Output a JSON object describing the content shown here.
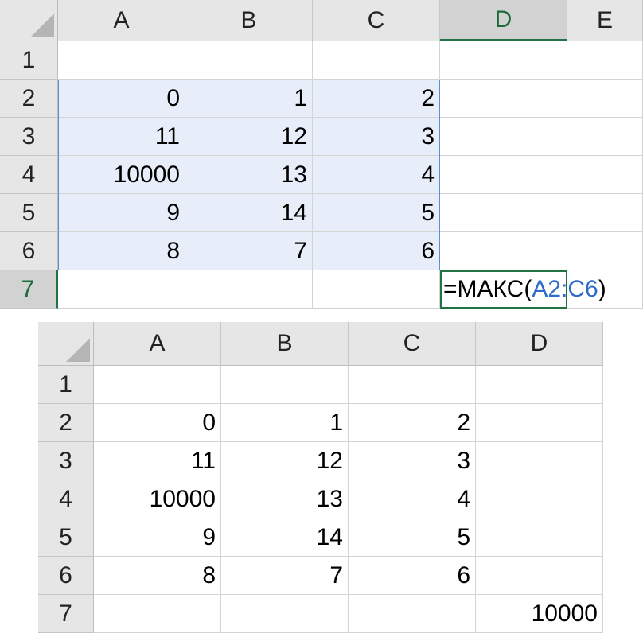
{
  "top_sheet": {
    "columns": [
      "A",
      "B",
      "C",
      "D",
      "E"
    ],
    "rows": [
      "1",
      "2",
      "3",
      "4",
      "5",
      "6",
      "7"
    ],
    "cells": [
      [
        "",
        "",
        "",
        "",
        ""
      ],
      [
        "0",
        "1",
        "2",
        "",
        ""
      ],
      [
        "11",
        "12",
        "3",
        "",
        ""
      ],
      [
        "10000",
        "13",
        "4",
        "",
        ""
      ],
      [
        "9",
        "14",
        "5",
        "",
        ""
      ],
      [
        "8",
        "7",
        "6",
        "",
        ""
      ],
      [
        "",
        "",
        "",
        "",
        ""
      ]
    ],
    "selected_column": "D",
    "selected_row": "7",
    "formula": {
      "prefix": "=МАКС(",
      "range_ref": "A2:C6",
      "suffix": ")"
    },
    "colors": {
      "selection_accent": "#217346",
      "range_fill": "#e8eef9",
      "range_border": "#5a8ed6",
      "range_ref_text": "#2f6cc9"
    }
  },
  "bottom_sheet": {
    "columns": [
      "A",
      "B",
      "C",
      "D"
    ],
    "rows": [
      "1",
      "2",
      "3",
      "4",
      "5",
      "6",
      "7"
    ],
    "cells": [
      [
        "",
        "",
        "",
        ""
      ],
      [
        "0",
        "1",
        "2",
        ""
      ],
      [
        "11",
        "12",
        "3",
        ""
      ],
      [
        "10000",
        "13",
        "4",
        ""
      ],
      [
        "9",
        "14",
        "5",
        ""
      ],
      [
        "8",
        "7",
        "6",
        ""
      ],
      [
        "",
        "",
        "",
        "10000"
      ]
    ]
  }
}
